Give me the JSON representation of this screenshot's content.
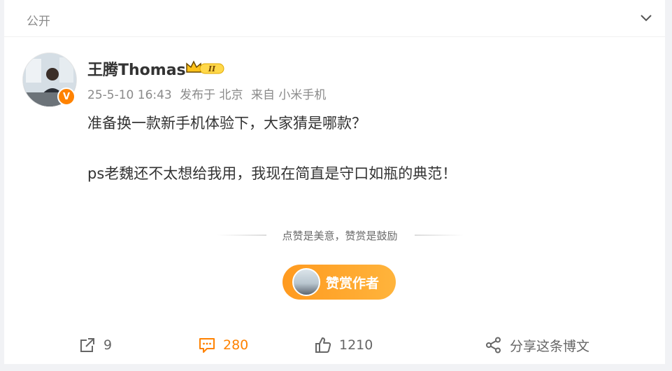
{
  "header": {
    "visibility": "公开"
  },
  "author": {
    "name": "王腾Thomas",
    "verified": true,
    "crown_level": "II"
  },
  "meta": {
    "time": "25-5-10 16:43",
    "location": "发布于 北京",
    "source": "来自 小米手机"
  },
  "post": {
    "paragraphs": [
      "准备换一款新手机体验下，大家猜是哪款？",
      "ps老魏还不太想给我用，我现在简直是守口如瓶的典范！"
    ]
  },
  "reward": {
    "divider_text": "点赞是美意，赞赏是鼓励",
    "button_label": "赞赏作者"
  },
  "actions": {
    "share_count": "9",
    "comment_count": "280",
    "like_count": "1210",
    "share_post_label": "分享这条博文"
  },
  "colors": {
    "accent": "#ff8200",
    "text": "#333333",
    "muted": "#8a8a8a"
  }
}
